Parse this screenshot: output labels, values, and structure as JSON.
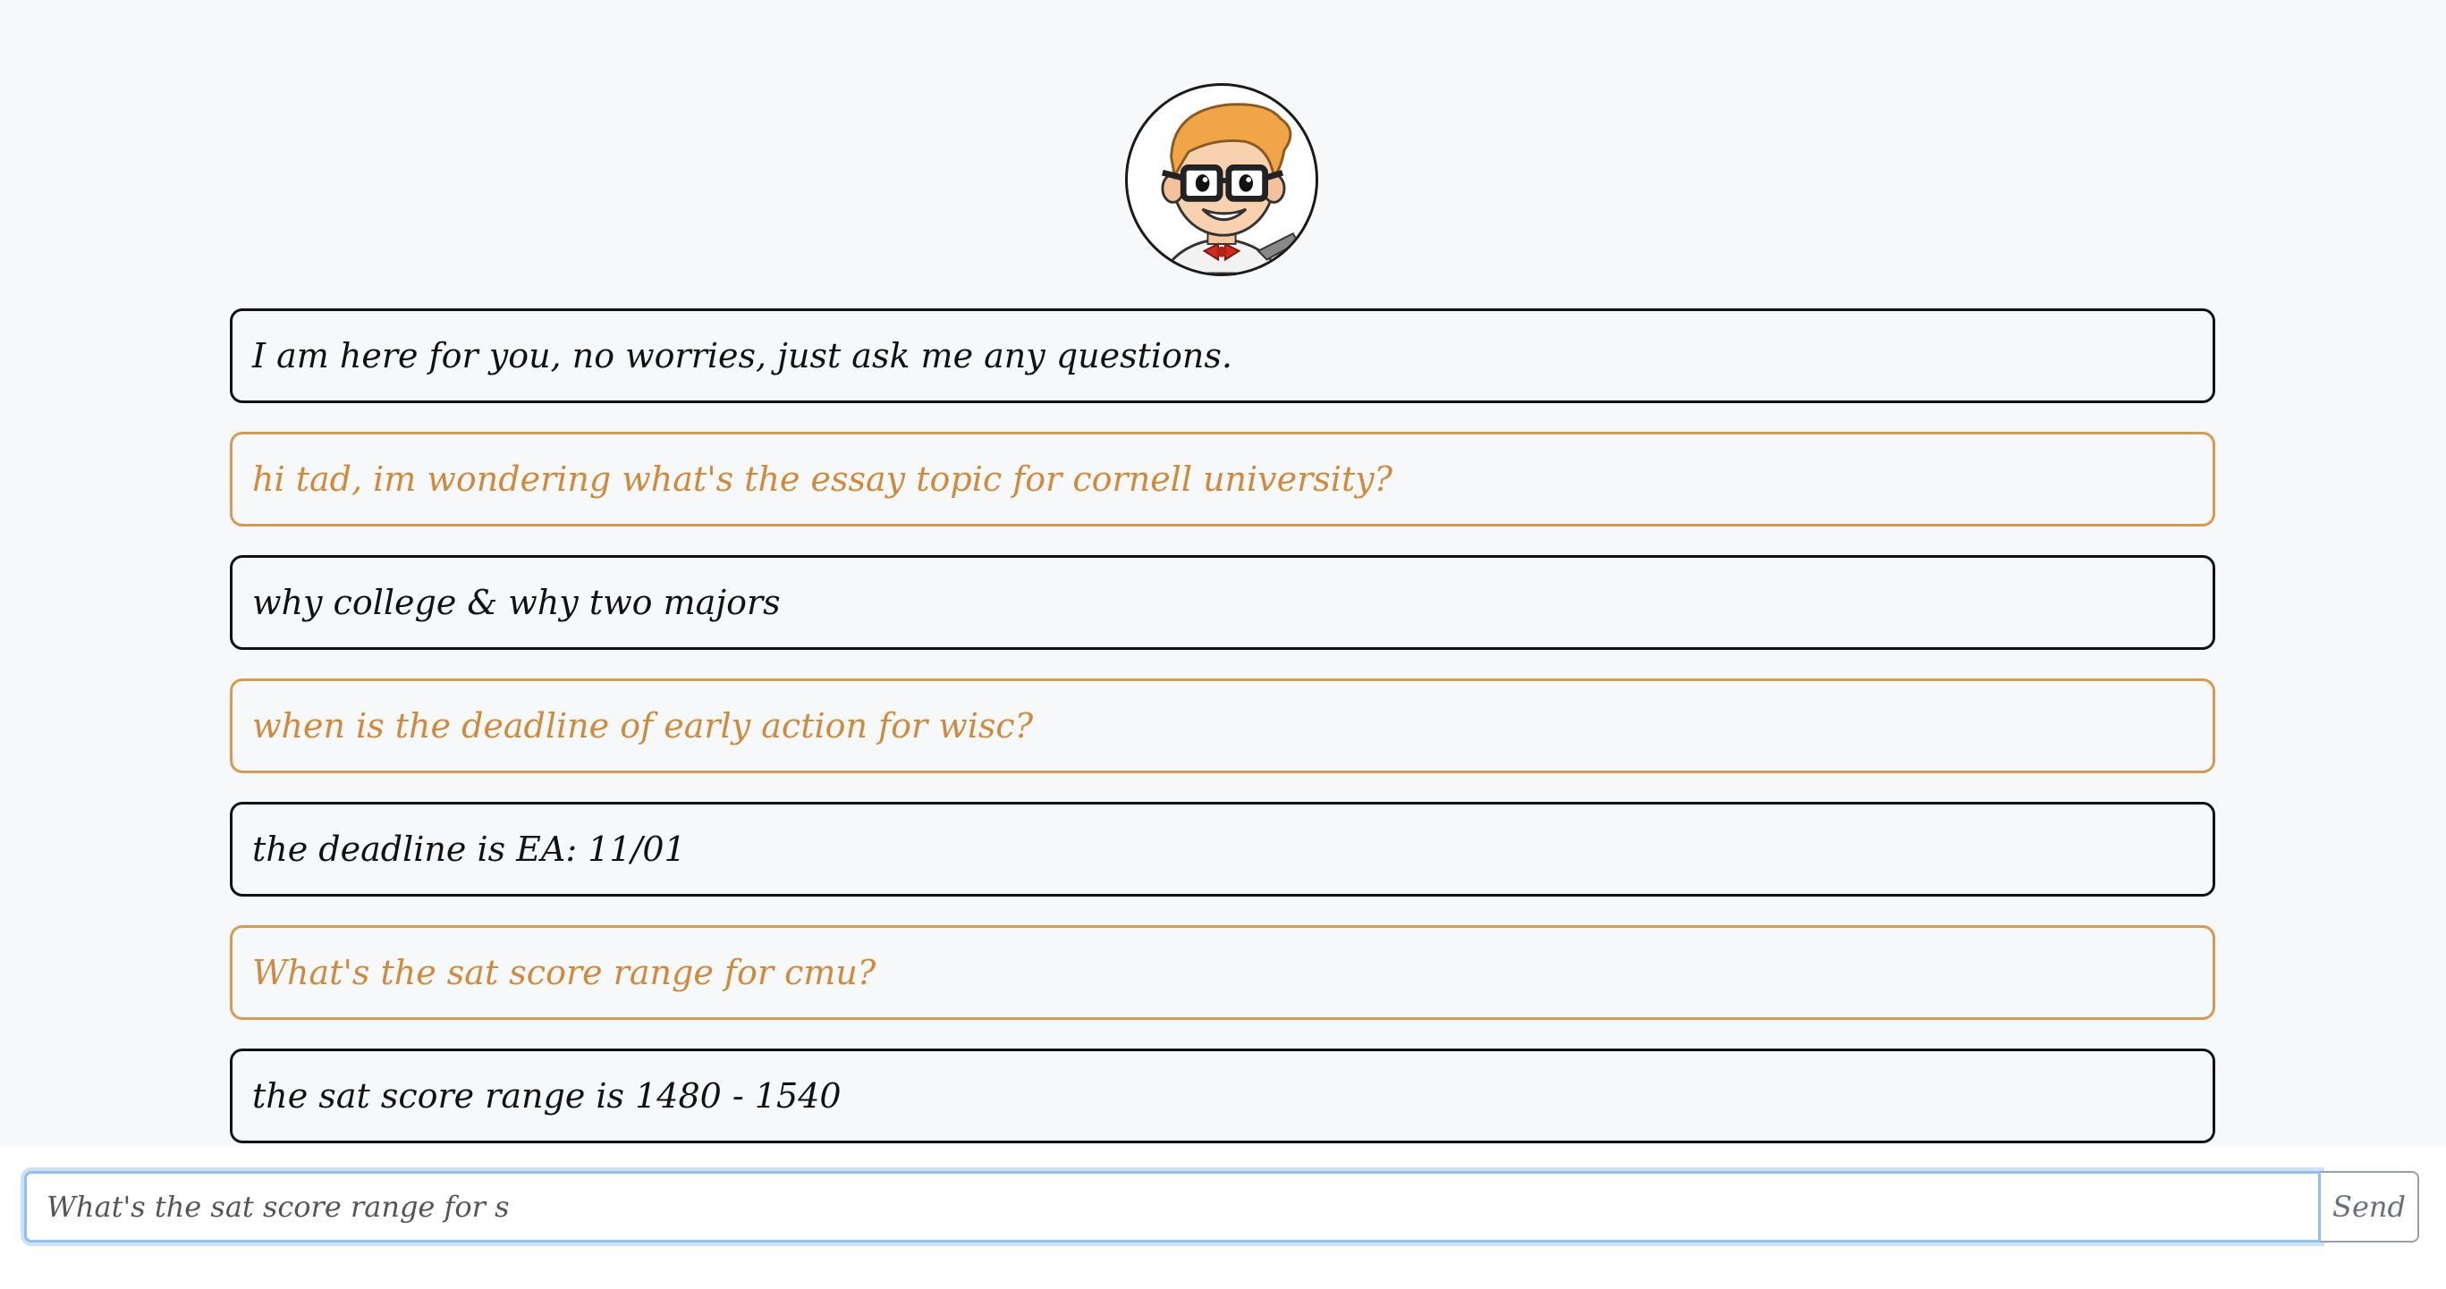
{
  "assistant": {
    "avatar_icon": "cartoon-nerd-avatar-icon"
  },
  "messages": [
    {
      "role": "bot",
      "text": "I am here for you, no worries, just ask me any questions."
    },
    {
      "role": "user",
      "text": "hi tad, im wondering what's the essay topic for cornell university?"
    },
    {
      "role": "bot",
      "text": "why college & why two majors"
    },
    {
      "role": "user",
      "text": "when is the deadline of early action for wisc?"
    },
    {
      "role": "bot",
      "text": "the deadline is EA: 11/01"
    },
    {
      "role": "user",
      "text": "What's the sat score range for cmu?"
    },
    {
      "role": "bot",
      "text": "the sat score range is 1480 - 1540"
    }
  ],
  "composer": {
    "value": "What's the sat score range for s",
    "send_label": "Send"
  },
  "colors": {
    "background": "#f7f8fa",
    "bot_border": "#111111",
    "user_accent": "#d08a3e",
    "input_focus": "#8fc0ee"
  }
}
